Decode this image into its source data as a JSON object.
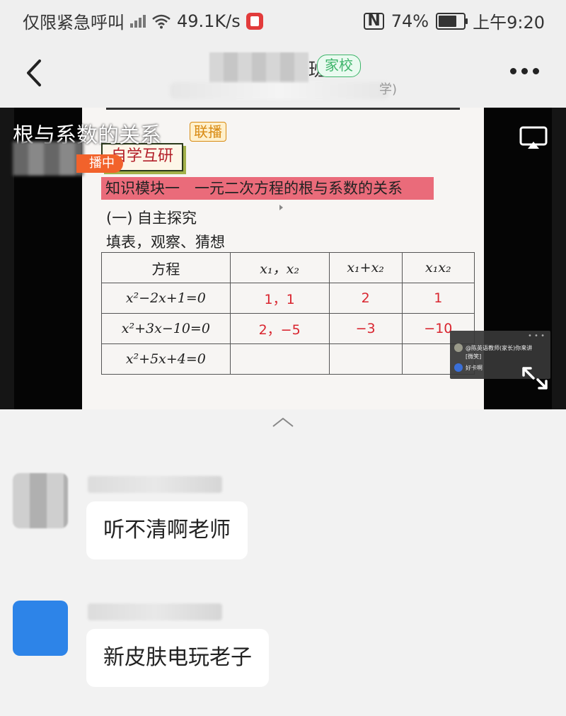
{
  "status_bar": {
    "carrier": "仅限紧急呼叫",
    "speed": "49.1K/s",
    "battery": "74%",
    "time": "上午9:20",
    "nfc": "N",
    "battery_level": 0.74
  },
  "nav": {
    "title_suffix": "班",
    "tag": "家校",
    "subtitle_end": "学)"
  },
  "video": {
    "title": "根与系数的关系",
    "live_tag": "联播",
    "live_badge": "播中",
    "slide": {
      "box_title": "自学互研",
      "module_bar": "知识模块一　一元二次方程的根与系数的关系",
      "explore": "(一) 自主探究",
      "guess": "填表，观察、猜想",
      "table": {
        "headers": [
          "方程",
          "x₁，x₂",
          "x₁+x₂",
          "x₁x₂"
        ],
        "rows": [
          [
            "x²−2x+1=0",
            "1，1",
            "2",
            "1"
          ],
          [
            "x²+3x−10=0",
            "2，−5",
            "−3",
            "−10"
          ],
          [
            "x²+5x+4=0",
            "",
            "",
            ""
          ]
        ]
      }
    },
    "mini_player": {
      "dots": "• • •",
      "line1": "@陈英语教师(家长)你来讲",
      "line1b": "[微笑]",
      "line2": "好卡啊"
    }
  },
  "messages": [
    {
      "text": "听不清啊老师"
    },
    {
      "text": "新皮肤电玩老子"
    }
  ],
  "colors": {
    "live_orange": "#f2622b",
    "module_pink": "#ea6b7a",
    "answer_red": "#d9252f",
    "home_tag_green": "#3fb56b"
  }
}
